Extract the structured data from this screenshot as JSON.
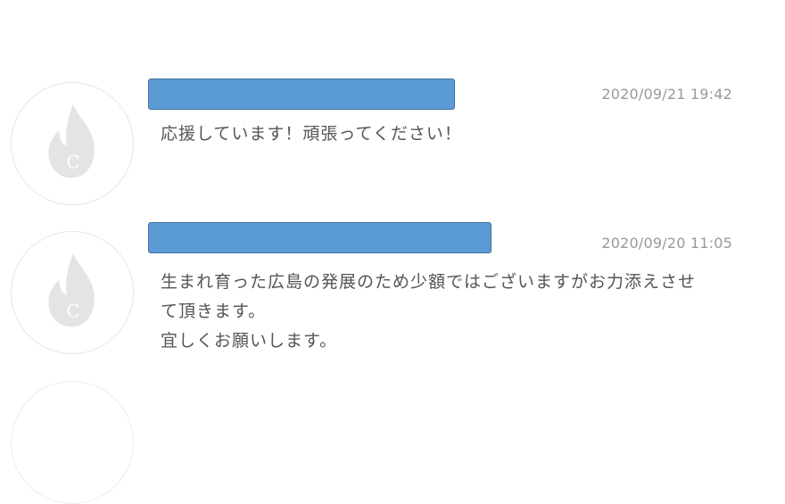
{
  "comments": [
    {
      "name_redacted": true,
      "timestamp": "2020/09/21 19:42",
      "message_lines": [
        "応援しています！頑張ってください！"
      ],
      "avatar_icon": "flame-c-icon"
    },
    {
      "name_redacted": true,
      "timestamp": "2020/09/20 11:05",
      "message_lines": [
        "生まれ育った広島の発展のため少額ではございますがお力添えさせ",
        "て頂きます。",
        "宜しくお願いします。"
      ],
      "avatar_icon": "flame-c-icon"
    }
  ],
  "colors": {
    "redaction_bar": "#5b9bd5",
    "redaction_border": "#41719c",
    "timestamp": "#999999",
    "message_text": "#555555",
    "avatar_icon": "#e4e4e4"
  }
}
